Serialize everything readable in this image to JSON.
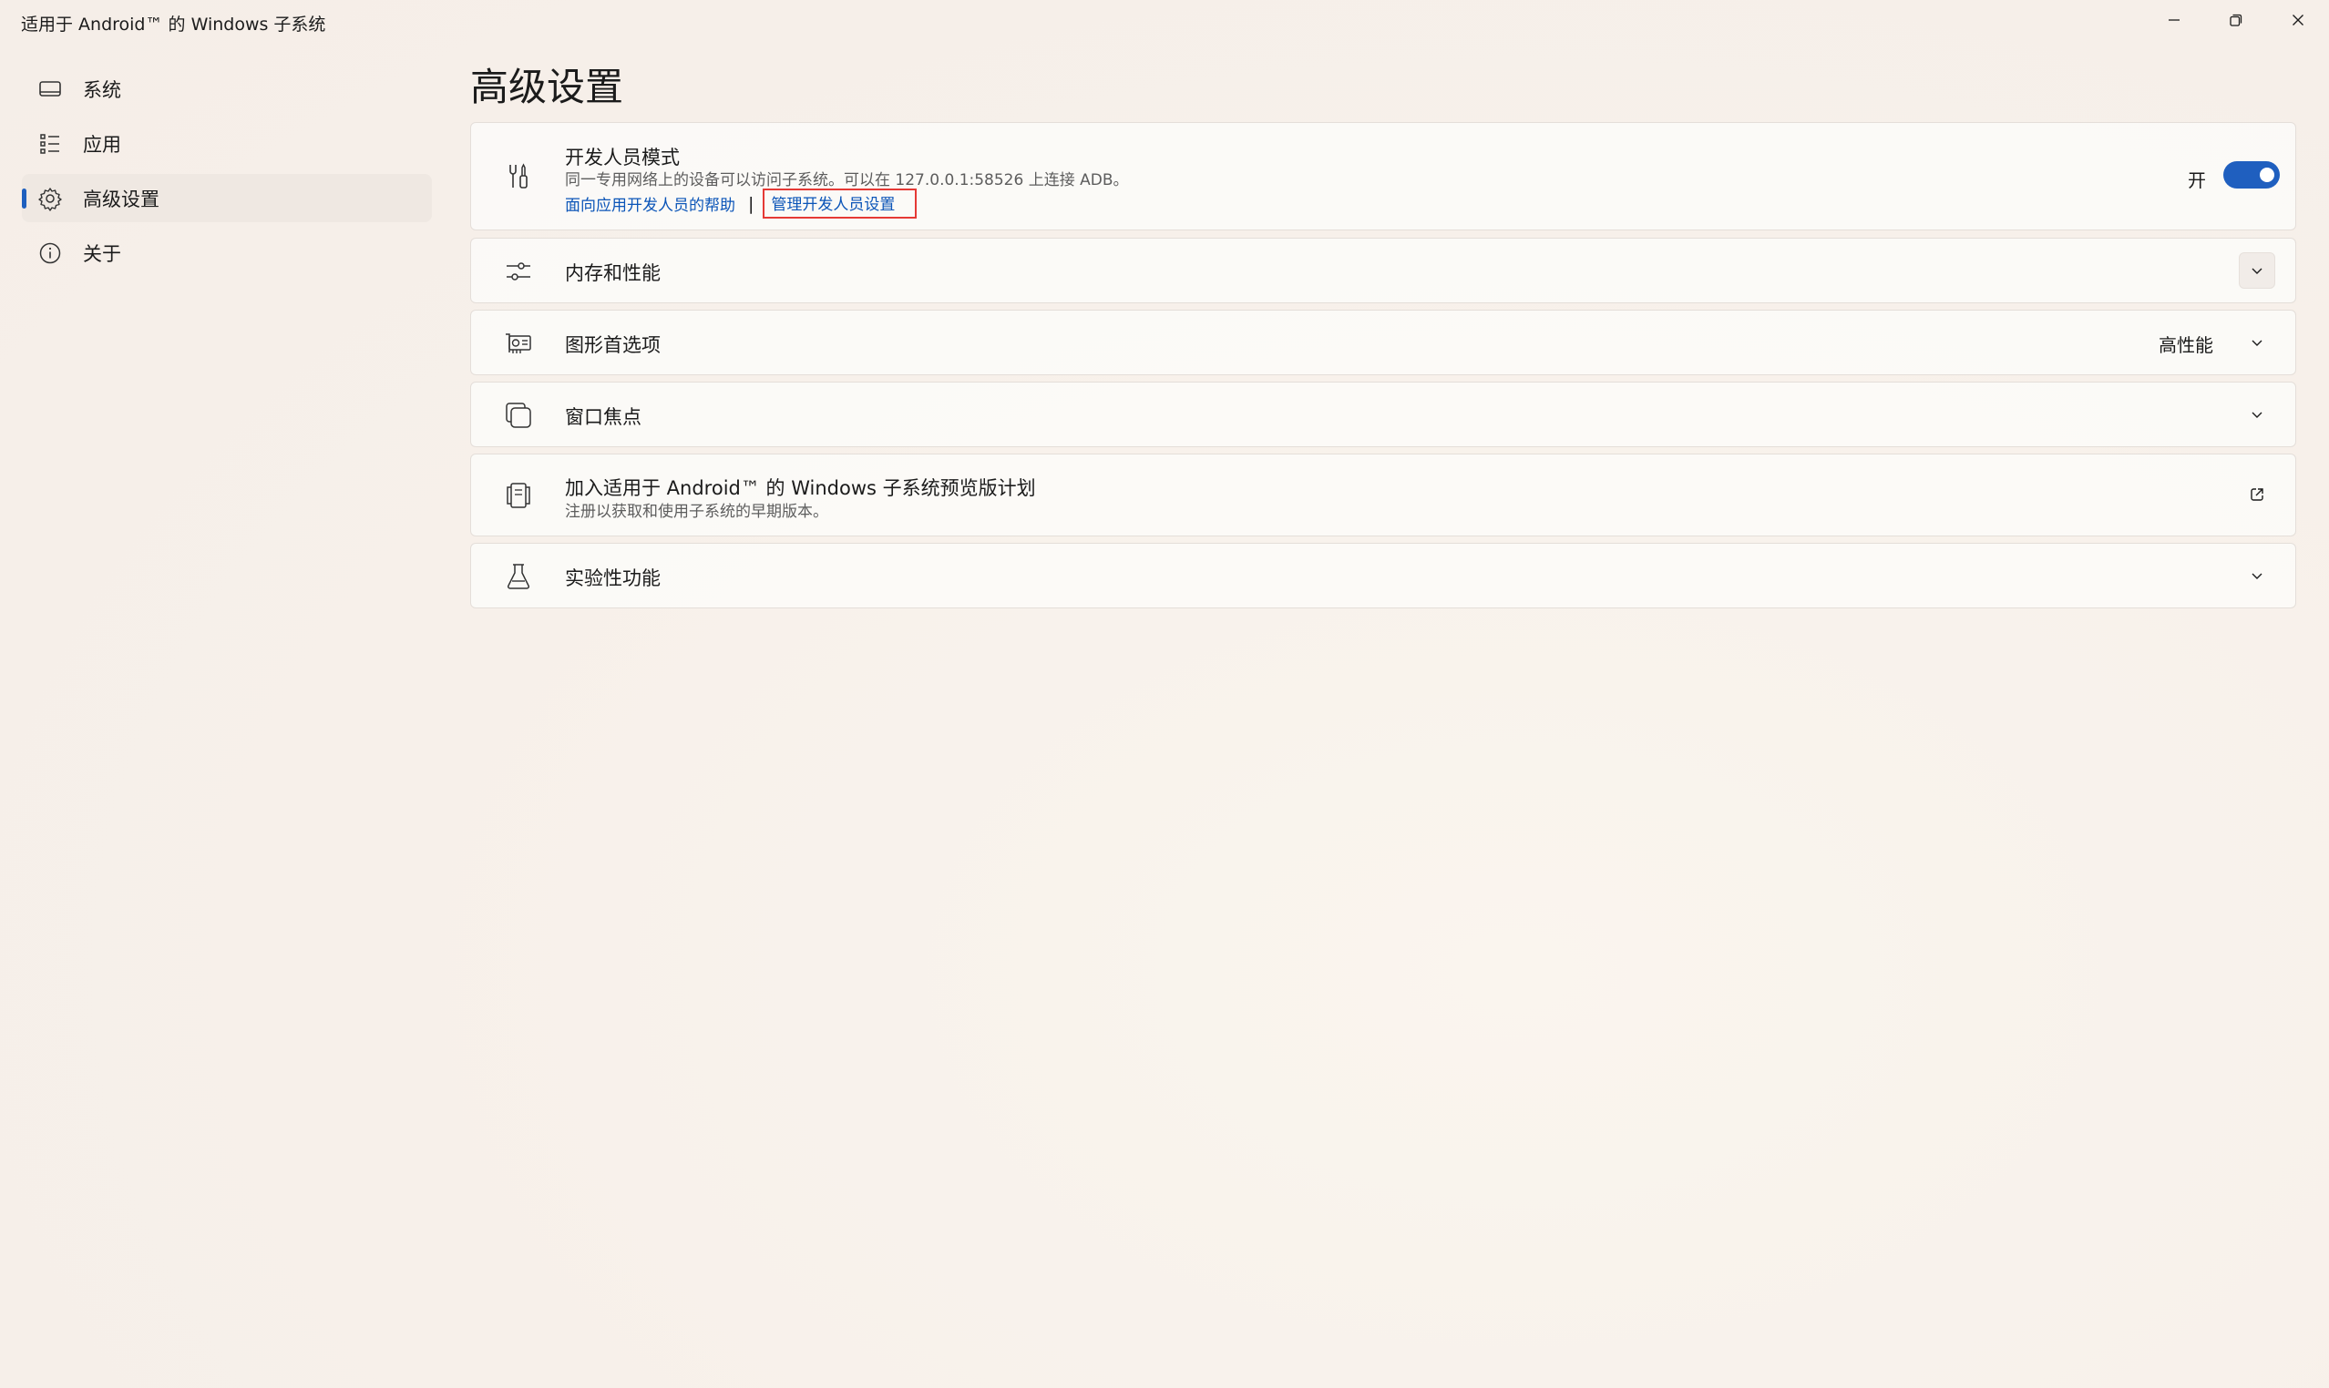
{
  "window": {
    "title": "适用于 Android™ 的 Windows 子系统",
    "controls": [
      "minimize-icon",
      "restore-icon",
      "close-icon"
    ]
  },
  "sidebar": {
    "items": [
      {
        "label": "系统",
        "icon": "laptop-icon",
        "active": false
      },
      {
        "label": "应用",
        "icon": "list-icon",
        "active": false
      },
      {
        "label": "高级设置",
        "icon": "gear-icon",
        "active": true
      },
      {
        "label": "关于",
        "icon": "info-icon",
        "active": false
      }
    ]
  },
  "main": {
    "title": "高级设置",
    "developer": {
      "icon": "tools-icon",
      "title": "开发人员模式",
      "description": "同一专用网络上的设备可以访问子系统。可以在 127.0.0.1:58526 上连接 ADB。",
      "link_help": "面向应用开发人员的帮助",
      "separator": "|",
      "link_manage": "管理开发人员设置",
      "toggle_label": "开",
      "toggle_on": true
    },
    "memory": {
      "icon": "sliders-icon",
      "title": "内存和性能"
    },
    "graphics": {
      "icon": "graphics-card-icon",
      "title": "图形首选项",
      "value": "高性能"
    },
    "focus": {
      "icon": "window-focus-icon",
      "title": "窗口焦点"
    },
    "preview": {
      "icon": "preview-program-icon",
      "title": "加入适用于 Android™ 的 Windows 子系统预览版计划",
      "description": "注册以获取和使用子系统的早期版本。"
    },
    "experimental": {
      "icon": "flask-icon",
      "title": "实验性功能"
    }
  },
  "colors": {
    "accent": "#1f5fbf",
    "link": "#0b55b8",
    "highlight_box": "#e53935"
  }
}
